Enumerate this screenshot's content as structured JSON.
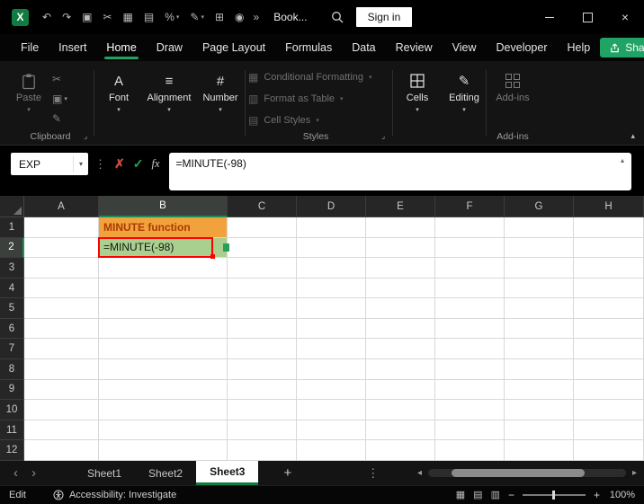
{
  "titlebar": {
    "logo_letter": "X",
    "doc_title": "Book...",
    "sign_in": "Sign in",
    "overflow": "»",
    "qat_icons": [
      {
        "name": "undo"
      },
      {
        "name": "redo"
      },
      {
        "name": "copy"
      },
      {
        "name": "cut"
      },
      {
        "name": "picture"
      },
      {
        "name": "table"
      },
      {
        "name": "percent-style",
        "chevron": true
      },
      {
        "name": "format-painter",
        "chevron": true
      },
      {
        "name": "borders"
      },
      {
        "name": "camera"
      }
    ]
  },
  "menu": {
    "items": [
      "File",
      "Insert",
      "Home",
      "Draw",
      "Page Layout",
      "Formulas",
      "Data",
      "Review",
      "View",
      "Developer",
      "Help"
    ],
    "active": "Home",
    "share": "Share"
  },
  "ribbon": {
    "paste": "Paste",
    "collapsed_groups": [
      "Font",
      "Alignment",
      "Number"
    ],
    "styles_items": [
      "Conditional Formatting",
      "Format as Table",
      "Cell Styles"
    ],
    "cells": "Cells",
    "editing": "Editing",
    "addins_button": "Add-ins",
    "group_labels": [
      "Clipboard",
      "Styles",
      "Add-ins"
    ]
  },
  "formula_bar": {
    "name_box": "EXP",
    "formula": "=MINUTE(-98)"
  },
  "grid": {
    "columns": [
      "A",
      "B",
      "C",
      "D",
      "E",
      "F",
      "G",
      "H"
    ],
    "row_count": 12,
    "selected_column": "B",
    "selected_row": "2",
    "cells": [
      {
        "ref": "B1",
        "text": "MINUTE function",
        "bg": "#F2A23C",
        "color": "#A93C00",
        "bold": true
      },
      {
        "ref": "B2",
        "text": "=MINUTE(-98)",
        "bg": "#A9D08E",
        "color": "#141414",
        "selected": true
      }
    ]
  },
  "sheet_tabs": {
    "tabs": [
      "Sheet1",
      "Sheet2",
      "Sheet3"
    ],
    "active": "Sheet3"
  },
  "status_bar": {
    "mode": "Edit",
    "accessibility": "Accessibility: Investigate",
    "zoom": "100%"
  },
  "colors": {
    "accent_green": "#21A366",
    "excel_green": "#107C41",
    "selection_border": "#FF0000",
    "cell_b1_fill": "#F2A23C",
    "cell_b2_fill": "#A9D08E"
  }
}
